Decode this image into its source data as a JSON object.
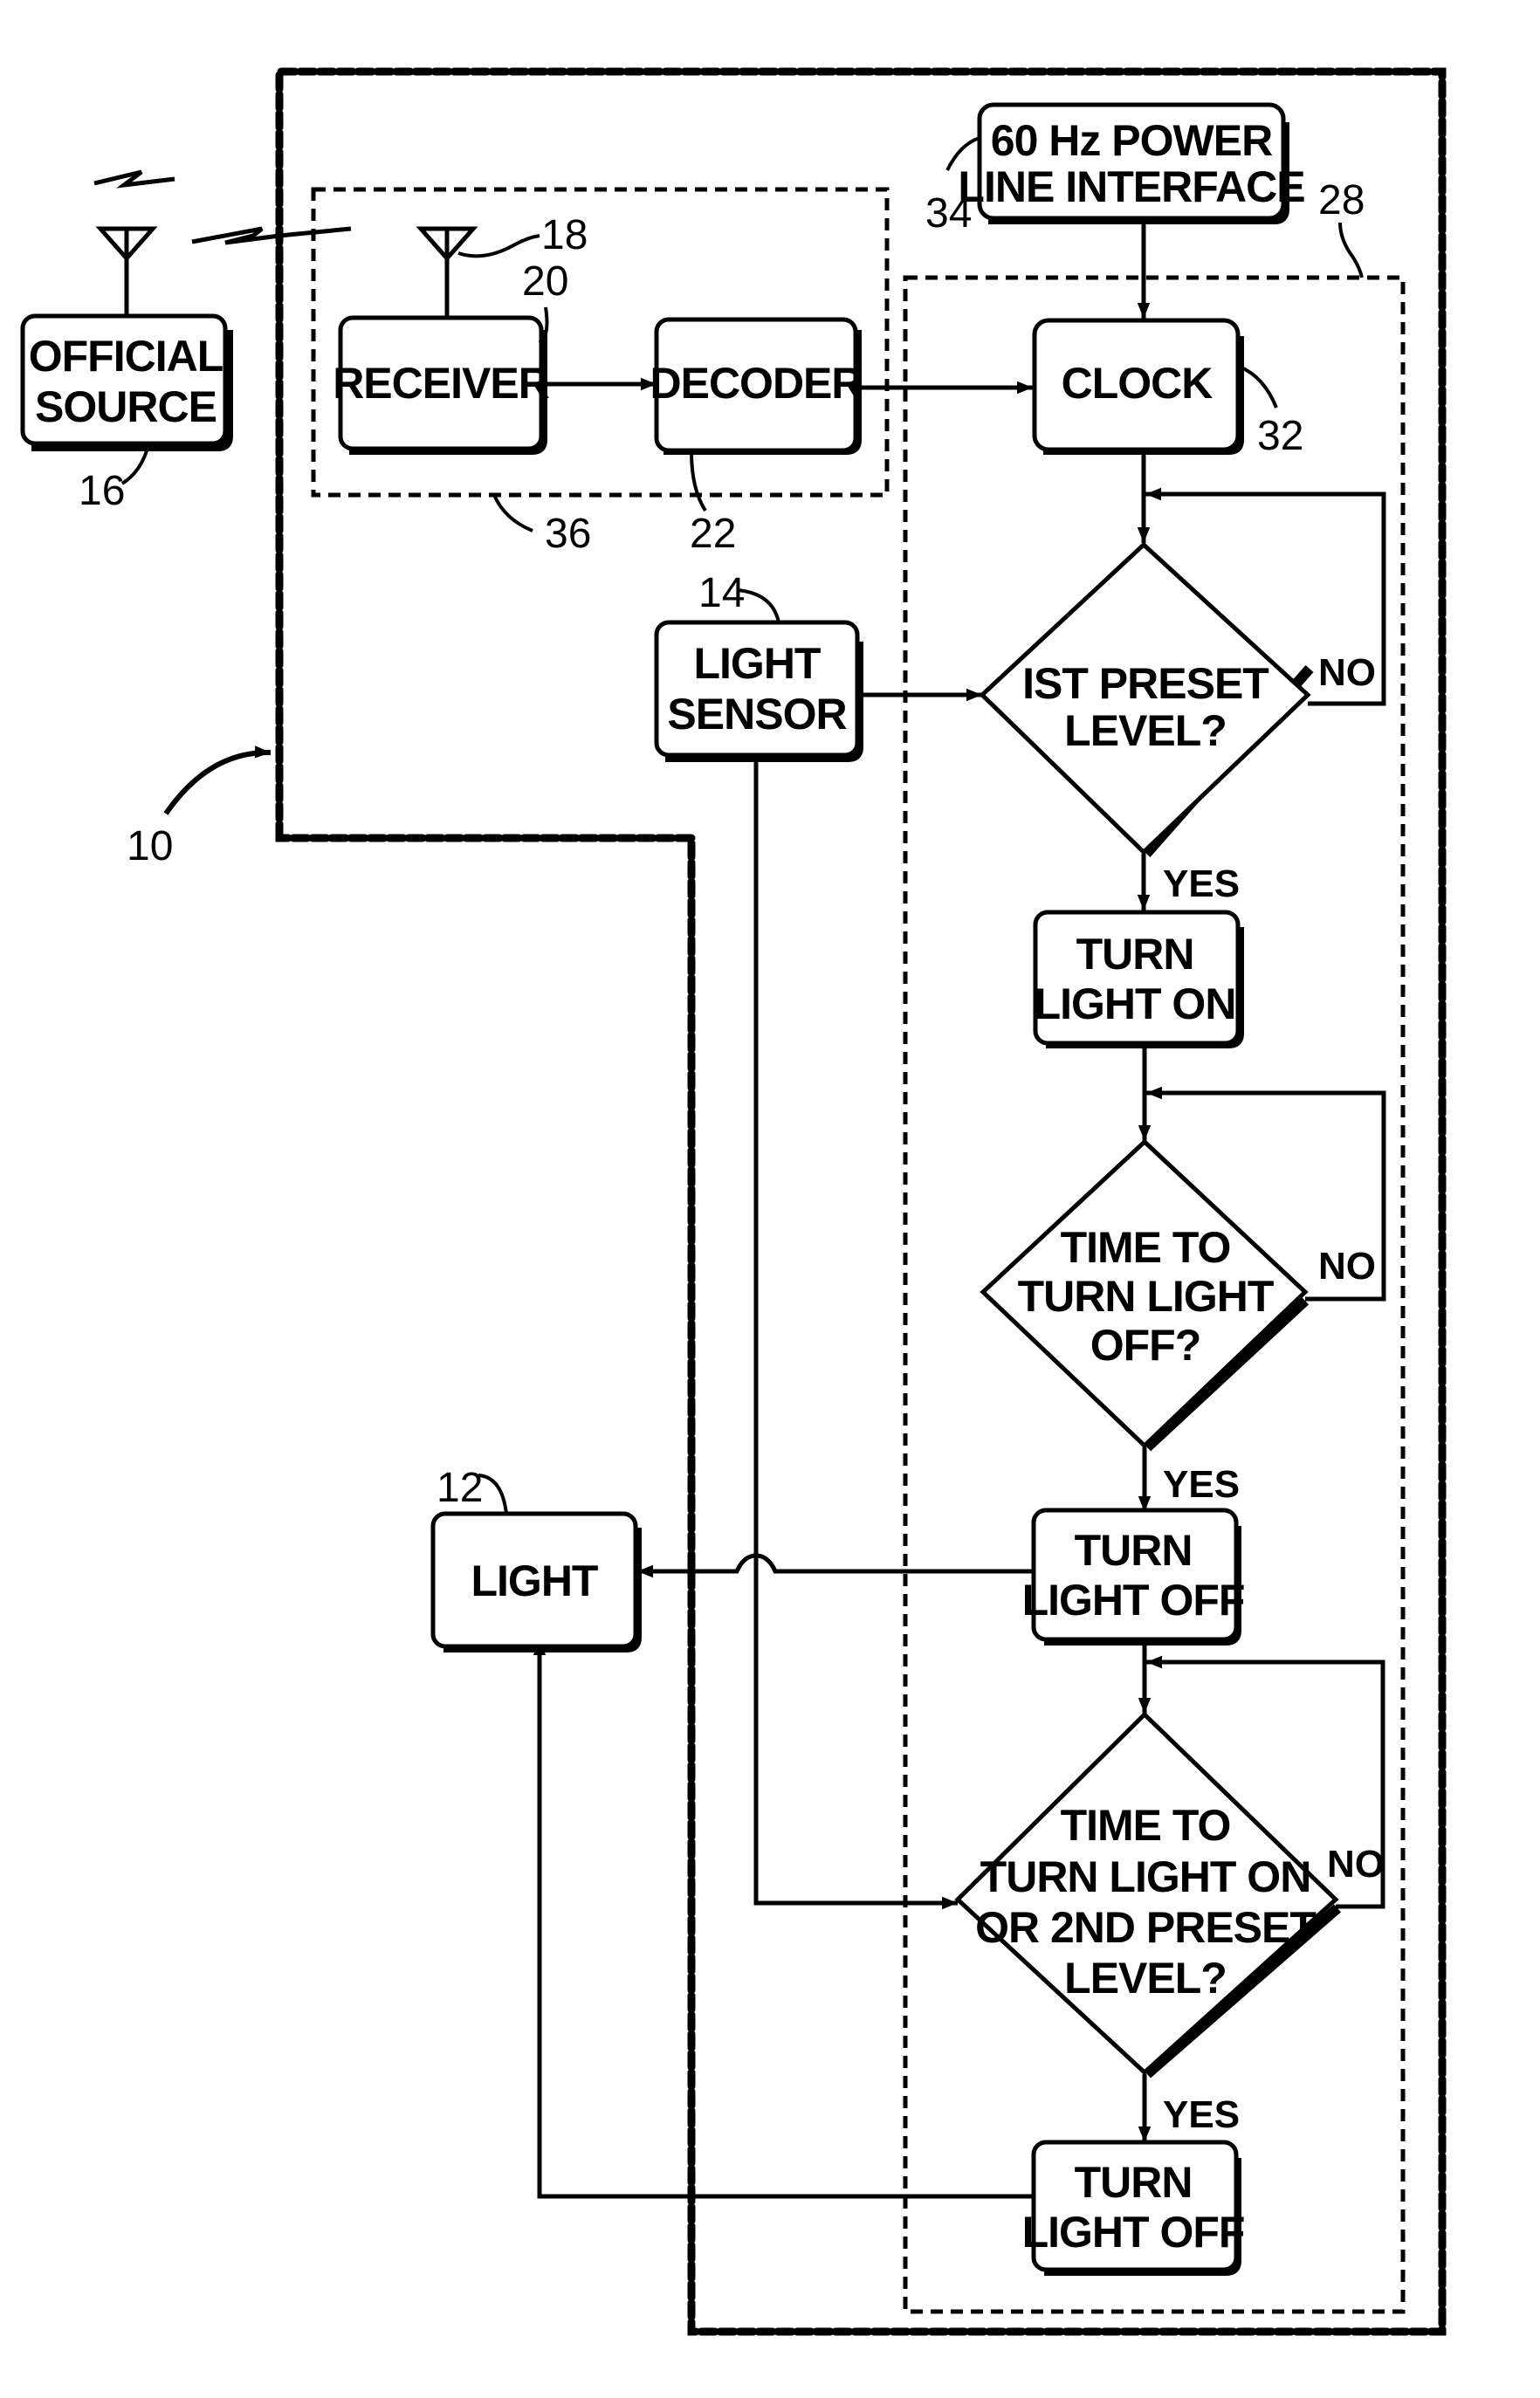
{
  "figure": {
    "type": "patent-flowchart",
    "background": "#ffffff",
    "ink": "#000000"
  },
  "blocks": {
    "official_source": {
      "lines": [
        "OFFICIAL",
        "SOURCE"
      ],
      "ref": "16"
    },
    "receiver": {
      "lines": [
        "RECEIVER"
      ],
      "ref": "20"
    },
    "decoder": {
      "lines": [
        "DECODER"
      ],
      "ref": "22"
    },
    "power_line": {
      "lines": [
        "60 Hz POWER",
        "LINE INTERFACE"
      ],
      "ref": "34"
    },
    "clock": {
      "lines": [
        "CLOCK"
      ],
      "ref": "32"
    },
    "light_sensor": {
      "lines": [
        "LIGHT",
        "SENSOR"
      ],
      "ref": "14"
    },
    "light": {
      "lines": [
        "LIGHT"
      ],
      "ref": "12"
    },
    "turn_on": {
      "lines": [
        "TURN",
        "LIGHT ON"
      ]
    },
    "turn_off_1": {
      "lines": [
        "TURN",
        "LIGHT OFF"
      ]
    },
    "turn_off_2": {
      "lines": [
        "TURN",
        "LIGHT OFF"
      ]
    }
  },
  "decisions": {
    "preset1": {
      "lines": [
        "IST PRESET",
        "LEVEL?"
      ],
      "yes": "YES",
      "no": "NO"
    },
    "time_off": {
      "lines": [
        "TIME TO",
        "TURN LIGHT",
        "OFF?"
      ],
      "yes": "YES",
      "no": "NO"
    },
    "time_on": {
      "lines": [
        "TIME TO",
        "TURN LIGHT ON",
        "OR 2ND PRESET",
        "LEVEL?"
      ],
      "yes": "YES",
      "no": "NO"
    }
  },
  "refs": {
    "system": "10",
    "antenna": "18",
    "controller": "28",
    "receiver_module": "36"
  }
}
